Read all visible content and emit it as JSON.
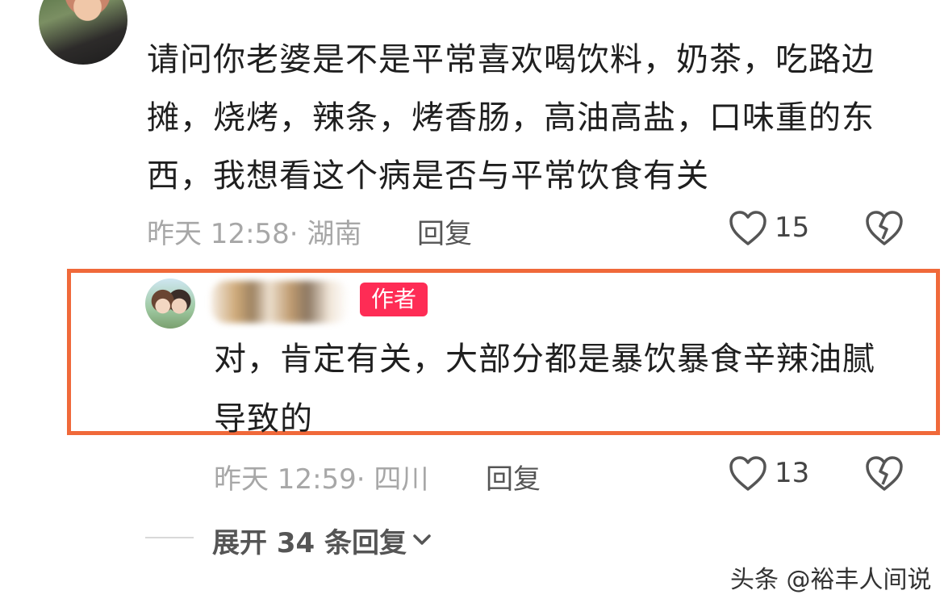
{
  "comment": {
    "text": "请问你老婆是不是平常喜欢喝饮料，奶茶，吃路边摊，烧烤，辣条，烤香肠，高油高盐，口味重的东西，我想看这个病是否与平常饮食有关",
    "meta": "昨天 12:58· 湖南",
    "reply_label": "回复",
    "like_count": "15"
  },
  "author_reply": {
    "badge": "作者",
    "text": "对，肯定有关，大部分都是暴饮暴食辛辣油腻导致的",
    "meta": "昨天 12:59· 四川",
    "reply_label": "回复",
    "like_count": "13"
  },
  "expand": {
    "label": "展开 34 条回复"
  },
  "watermark": "头条 @裕丰人间说",
  "colors": {
    "highlight_border": "#f0693a",
    "badge_bg": "#fe2c55"
  }
}
